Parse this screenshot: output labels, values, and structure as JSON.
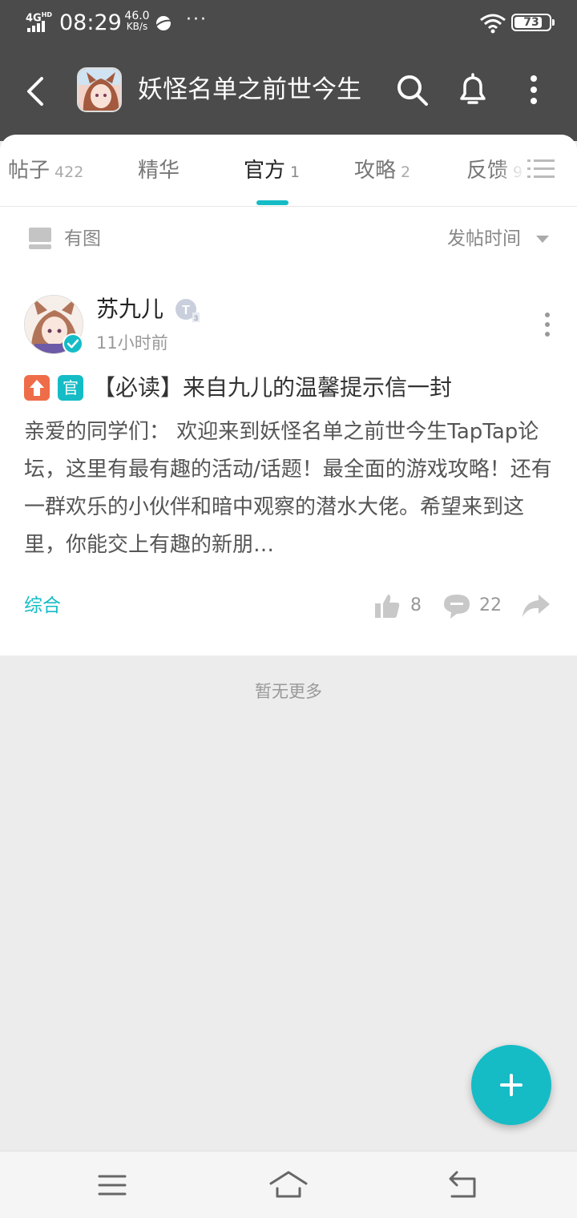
{
  "status_bar": {
    "network": "4G",
    "network_sup": "HD",
    "time": "08:29",
    "speed_value": "46.0",
    "speed_unit": "KB/s",
    "more": "···",
    "battery": "73"
  },
  "app_bar": {
    "title": "妖怪名单之前世今生"
  },
  "tabs": [
    {
      "label": "帖子",
      "count": "422"
    },
    {
      "label": "精华",
      "count": ""
    },
    {
      "label": "官方",
      "count": "1"
    },
    {
      "label": "攻略",
      "count": "2"
    },
    {
      "label": "反馈",
      "count": "9"
    }
  ],
  "filters": {
    "has_image_label": "有图",
    "sort_label": "发帖时间"
  },
  "post": {
    "author": "苏九儿",
    "time": "11小时前",
    "tag_official": "官",
    "title": "【必读】来自九儿的温馨提示信一封",
    "body": "亲爱的同学们： 欢迎来到妖怪名单之前世今生TapTap论坛，这里有最有趣的活动/话题！最全面的游戏攻略！还有一群欢乐的小伙伴和暗中观察的潜水大佬。希望来到这里，你能交上有趣的新朋…",
    "category": "综合",
    "likes": "8",
    "comments": "22"
  },
  "list_end_text": "暂无更多",
  "colors": {
    "accent": "#15bcc6",
    "header_bg": "#4a4b4a",
    "up_tag": "#ee6d48"
  }
}
